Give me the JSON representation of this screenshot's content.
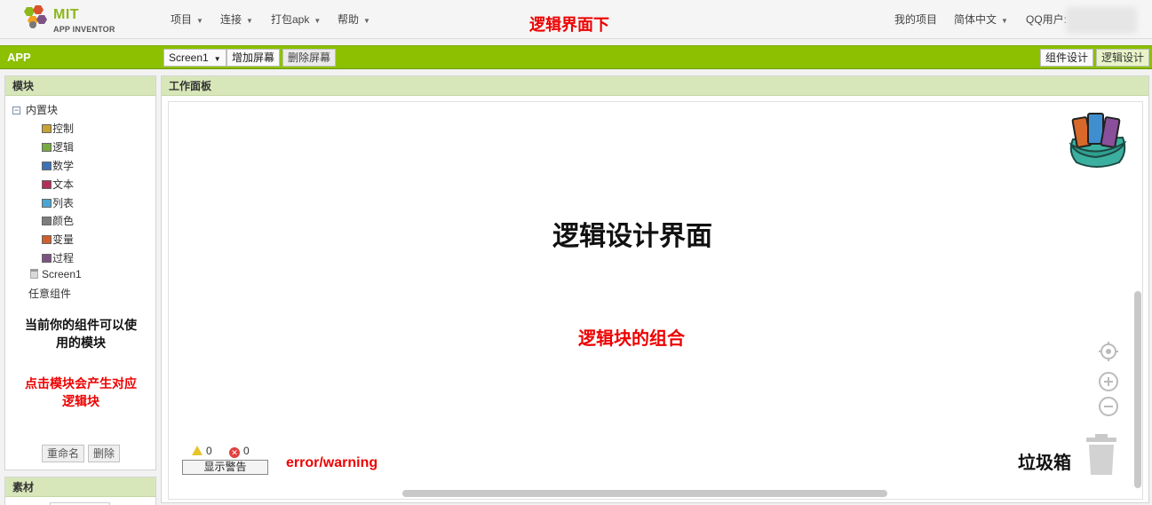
{
  "app": {
    "logo_mit": "MIT",
    "logo_sub": "APP INVENTOR"
  },
  "nav": {
    "items": [
      {
        "label": "项目"
      },
      {
        "label": "连接"
      },
      {
        "label": "打包apk"
      },
      {
        "label": "帮助"
      }
    ],
    "my_projects": "我的项目",
    "language": "简体中文",
    "user": "QQ用户:"
  },
  "annotations": {
    "top": "逻辑界面下",
    "left_black": "当前你的组件可以使用的模块",
    "left_red": "点击模块会产生对应逻辑块",
    "workspace_title": "逻辑设计界面",
    "workspace_sub": "逻辑块的组合",
    "error_label": "error/warning",
    "trash_label": "垃圾箱"
  },
  "toolbar": {
    "project_name": "APP",
    "screen_select": "Screen1",
    "add_screen": "增加屏幕",
    "remove_screen": "删除屏幕",
    "designer": "组件设计",
    "blocks": "逻辑设计"
  },
  "blocks_panel": {
    "title": "模块",
    "builtin": "内置块",
    "categories": [
      {
        "label": "控制",
        "color": "#c8a234"
      },
      {
        "label": "逻辑",
        "color": "#77ab41"
      },
      {
        "label": "数学",
        "color": "#3f71b5"
      },
      {
        "label": "文本",
        "color": "#b32d5e"
      },
      {
        "label": "列表",
        "color": "#49a6d4"
      },
      {
        "label": "颜色",
        "color": "#7d7d7d"
      },
      {
        "label": "变量",
        "color": "#d05f2d"
      },
      {
        "label": "过程",
        "color": "#7c5385"
      }
    ],
    "screen_item": "Screen1",
    "any_component": "任意组件",
    "rename": "重命名",
    "delete": "删除"
  },
  "media_panel": {
    "title": "素材"
  },
  "workspace": {
    "title": "工作面板",
    "warnings_count": "0",
    "errors_count": "0",
    "show_warnings": "显示警告"
  }
}
